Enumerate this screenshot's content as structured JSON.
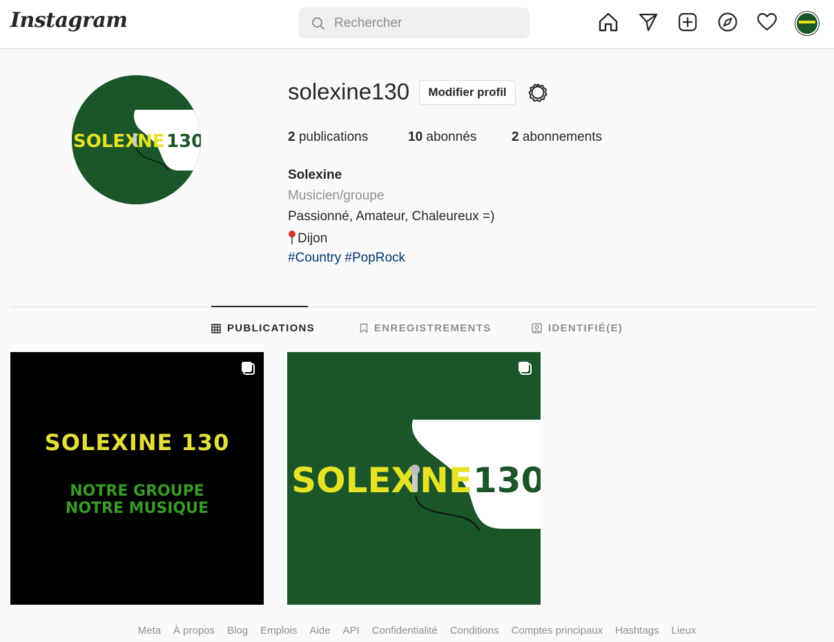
{
  "header": {
    "logo_text": "Instagram",
    "search_placeholder": "Rechercher",
    "icons": [
      "home-icon",
      "direct-message-icon",
      "new-post-icon",
      "explore-icon",
      "activity-heart-icon",
      "profile-avatar"
    ]
  },
  "profile": {
    "username": "solexine130",
    "edit_button": "Modifier profil",
    "stats": {
      "posts_count": "2",
      "posts_label": "publications",
      "followers_count": "10",
      "followers_label": "abonnés",
      "following_count": "2",
      "following_label": "abonnements"
    },
    "bio": {
      "name": "Solexine",
      "category": "Musicien/groupe",
      "line1": "Passionné, Amateur, Chaleureux =)",
      "line2": "Dijon",
      "hashtag1": "#Country",
      "hashtag2": "#PopRock"
    },
    "avatar_logo": {
      "left": "SOLEX",
      "middle": "NE",
      "right": "130"
    }
  },
  "tabs": [
    {
      "label": "PUBLICATIONS",
      "active": true
    },
    {
      "label": "ENREGISTREMENTS",
      "active": false
    },
    {
      "label": "IDENTIFIÉ(E)",
      "active": false
    }
  ],
  "posts": [
    {
      "title": "SOLEXINE 130",
      "subtitle_1": "NOTRE GROUPE",
      "subtitle_2": "NOTRE MUSIQUE"
    },
    {
      "logo_left": "SOLEX",
      "logo_middle": "NE",
      "logo_right": "130"
    }
  ],
  "footer": {
    "links": [
      "Meta",
      "À propos",
      "Blog",
      "Emplois",
      "Aide",
      "API",
      "Confidentialité",
      "Conditions",
      "Comptes principaux",
      "Hashtags",
      "Lieux"
    ]
  },
  "colors": {
    "brand_green": "#1b5629",
    "logo_yellow": "#e6e224",
    "link_blue": "#00376b"
  }
}
